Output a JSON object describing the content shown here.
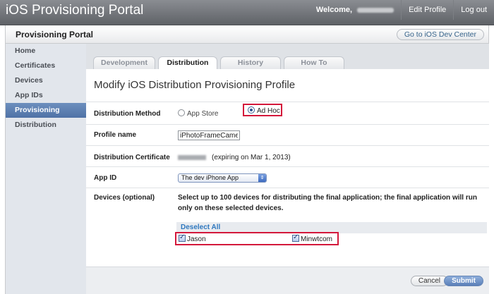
{
  "app": {
    "title": "iOS Provisioning Portal",
    "welcome_label": "Welcome,",
    "edit_profile": "Edit Profile",
    "log_out": "Log out"
  },
  "header": {
    "heading": "Provisioning Portal",
    "dev_center_button": "Go to iOS Dev Center"
  },
  "sidebar": {
    "items": [
      {
        "label": "Home",
        "active": false
      },
      {
        "label": "Certificates",
        "active": false
      },
      {
        "label": "Devices",
        "active": false
      },
      {
        "label": "App IDs",
        "active": false
      },
      {
        "label": "Provisioning",
        "active": true
      },
      {
        "label": "Distribution",
        "active": false
      }
    ]
  },
  "tabs": [
    {
      "label": "Development",
      "active": false
    },
    {
      "label": "Distribution",
      "active": true
    },
    {
      "label": "History",
      "active": false
    },
    {
      "label": "How To",
      "active": false
    }
  ],
  "form": {
    "title": "Modify iOS Distribution Provisioning Profile",
    "method_label": "Distribution Method",
    "method_options": [
      "App Store",
      "Ad Hoc"
    ],
    "method_selected": "Ad Hoc",
    "profile_name_label": "Profile name",
    "profile_name_value": "iPhotoFrameCamera",
    "certificate_label": "Distribution Certificate",
    "certificate_expiry": "(expiring on Mar 1, 2013)",
    "app_id_label": "App ID",
    "app_id_selected": "The dev iPhone App",
    "devices_label": "Devices (optional)",
    "devices_description": "Select up to 100 devices for distributing the final application; the final application will run only on these selected devices.",
    "deselect_all": "Deselect All",
    "devices": [
      {
        "name": "Jason",
        "checked": true
      },
      {
        "name": "Minwtcom",
        "checked": true
      }
    ]
  },
  "buttons": {
    "cancel": "Cancel",
    "submit": "Submit"
  },
  "colors": {
    "highlight": "#d4183b",
    "sidebar_active": "#5677aa",
    "link": "#2f78bf"
  }
}
